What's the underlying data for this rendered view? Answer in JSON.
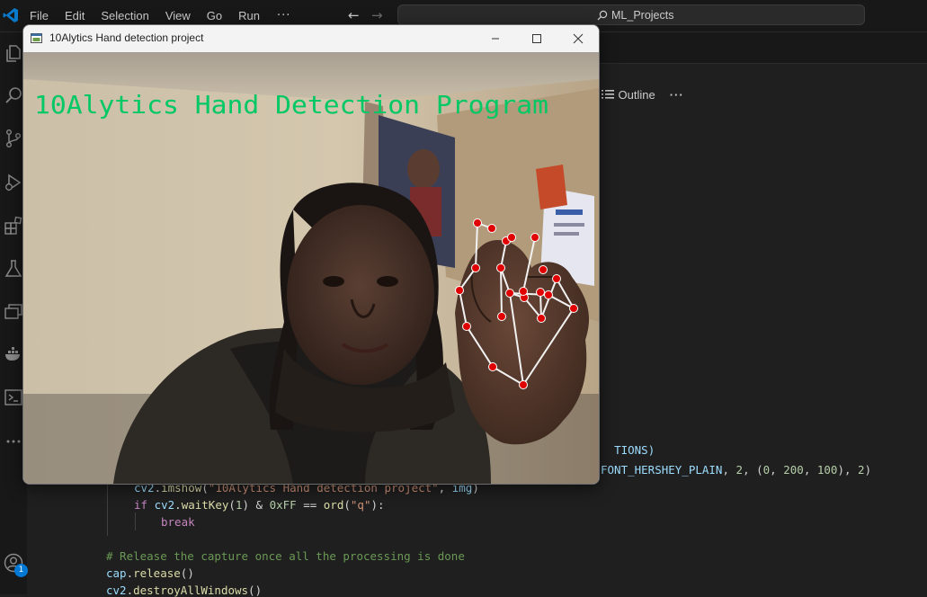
{
  "vscode": {
    "menu": [
      "File",
      "Edit",
      "Selection",
      "View",
      "Go",
      "Run"
    ],
    "menu_more": "···",
    "search_text": "ML_Projects",
    "outline_label": "Outline",
    "outline_more": "···",
    "accounts_badge": "1",
    "colors": {
      "bg": "#1f1f1f",
      "bar": "#181818",
      "accent": "#0078d4"
    }
  },
  "code": {
    "line_tions": "TIONS)",
    "line_puttext_tail": {
      "part1": "FONT_HERSHEY_PLAIN",
      "part2": ", ",
      "n1": "2",
      "part3": ", (",
      "n2": "0",
      "part4": ", ",
      "n3": "200",
      "part5": ", ",
      "n4": "100",
      "part6": "), ",
      "n5": "2",
      "part7": ")"
    },
    "line_imshow": {
      "obj": "cv2",
      "fn": "imshow",
      "str": "\"10Alytics Hand detection project\"",
      "arg": "img"
    },
    "line_if": {
      "kw": "if",
      "obj": "cv2",
      "fn": "waitKey",
      "n1": "1",
      "amp": " & ",
      "hex": "0xFF",
      "eq": " == ",
      "fn2": "ord",
      "str": "\"q\""
    },
    "line_break": "break",
    "line_comment": "# Release the capture once all the processing is done",
    "line_release": {
      "obj": "cap",
      "fn": "release"
    },
    "line_destroy": {
      "obj": "cv2",
      "fn": "destroyAllWindows"
    }
  },
  "opencv_window": {
    "title": "10Alytics Hand detection project",
    "overlay_text": "10Alytics Hand Detection Program",
    "overlay_color": "#00c864",
    "landmark_color": "#e00000"
  }
}
